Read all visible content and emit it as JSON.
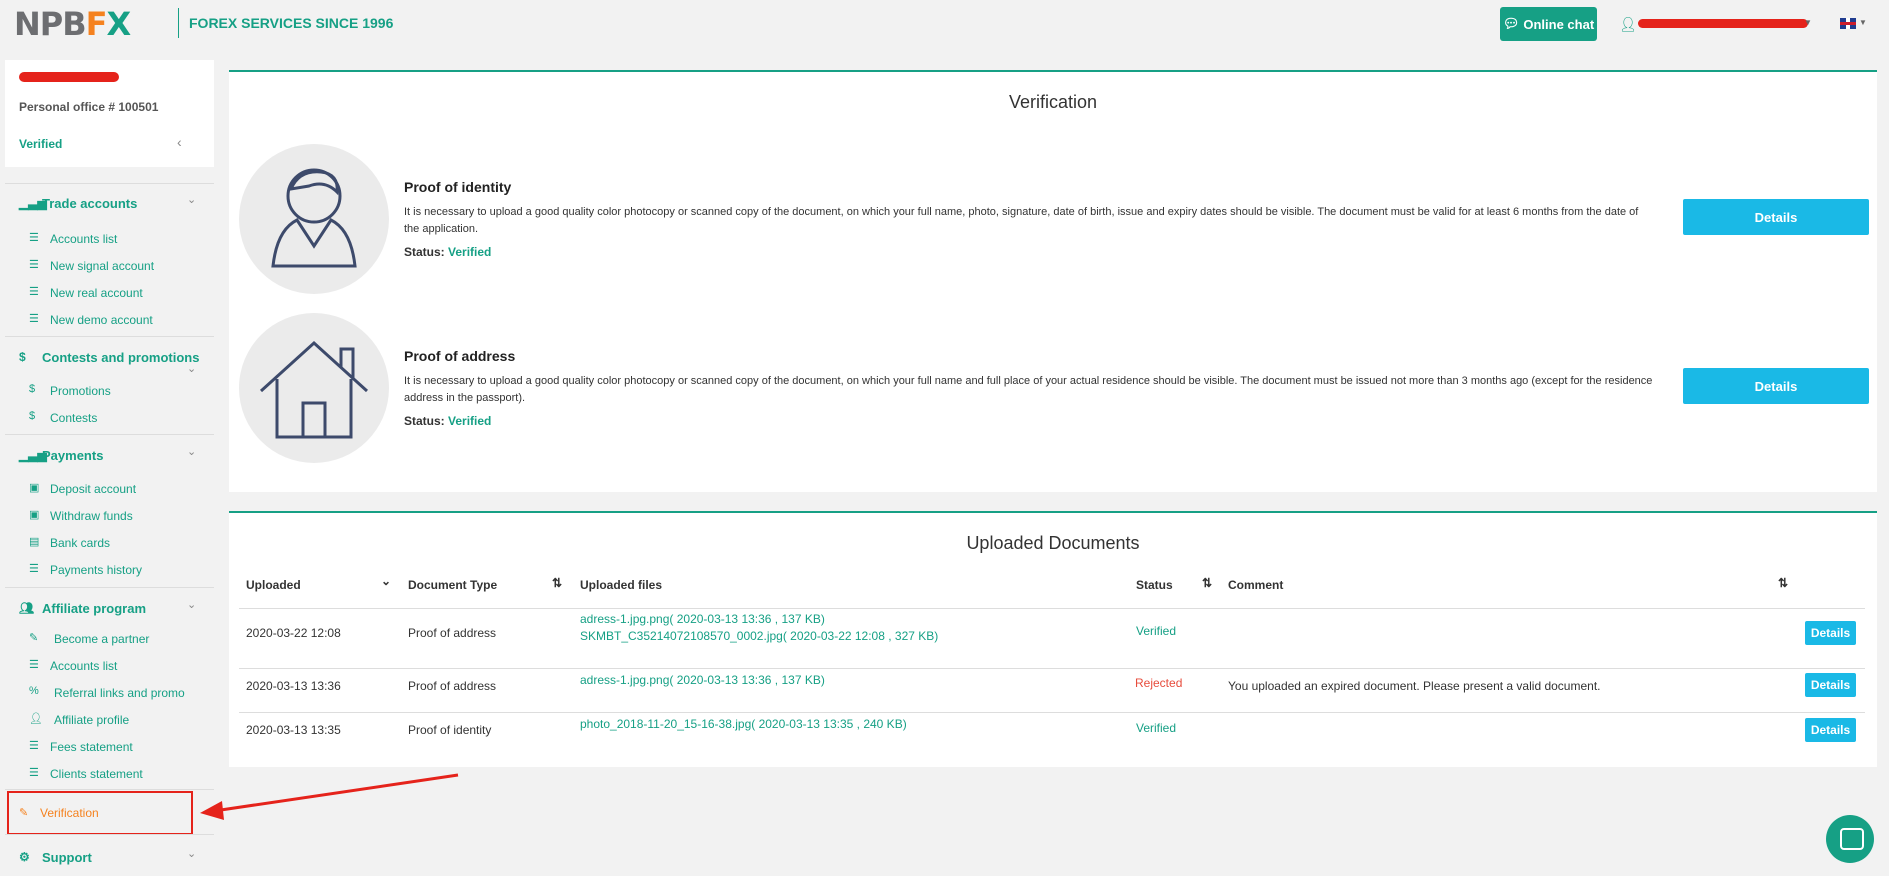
{
  "header": {
    "logo_npb": "NPB",
    "logo_f": "F",
    "logo_x": "X",
    "tagline": "FOREX SERVICES SINCE 1996",
    "online_chat_label": "Online chat"
  },
  "profile": {
    "office": "Personal office # 100501",
    "status": "Verified"
  },
  "sidebar": {
    "trade_accounts": {
      "label": "Trade accounts",
      "items": [
        "Accounts list",
        "New signal account",
        "New real account",
        "New demo account"
      ]
    },
    "contests": {
      "label": "Contests and promotions",
      "items": [
        "Promotions",
        "Contests"
      ]
    },
    "payments": {
      "label": "Payments",
      "items": [
        "Deposit account",
        "Withdraw funds",
        "Bank cards",
        "Payments history"
      ]
    },
    "affiliate": {
      "label": "Affiliate program",
      "items": [
        "Become a partner",
        "Accounts list",
        "Referral links and promo",
        "Affiliate profile",
        "Fees statement",
        "Clients statement"
      ]
    },
    "verification_label": "Verification",
    "support_label": "Support"
  },
  "verification": {
    "title": "Verification",
    "identity": {
      "title": "Proof of identity",
      "text": "It is necessary to upload a good quality color photocopy or scanned copy of the document, on which your full name, photo, signature, date of birth, issue and expiry dates should be visible. The document must be valid for at least 6 months from the date of the application.",
      "status_label": "Status:",
      "status_value": "Verified",
      "button": "Details"
    },
    "address": {
      "title": "Proof of address",
      "text": "It is necessary to upload a good quality color photocopy or scanned copy of the document, on which your full name and full place of your actual residence should be visible. The document must be issued not more than 3 months ago (except for the residence address in the passport).",
      "status_label": "Status:",
      "status_value": "Verified",
      "button": "Details"
    }
  },
  "uploads": {
    "title": "Uploaded Documents",
    "columns": [
      "Uploaded",
      "Document Type",
      "Uploaded files",
      "Status",
      "Comment"
    ],
    "rows": [
      {
        "uploaded": "2020-03-22 12:08",
        "type": "Proof of address",
        "files": [
          "adress-1.jpg.png( 2020-03-13 13:36 , 137 KB)",
          "SKMBT_C35214072108570_0002.jpg( 2020-03-22 12:08 , 327 KB)"
        ],
        "status": "Verified",
        "comment": "",
        "button": "Details"
      },
      {
        "uploaded": "2020-03-13 13:36",
        "type": "Proof of address",
        "files": [
          "adress-1.jpg.png( 2020-03-13 13:36 , 137 KB)"
        ],
        "status": "Rejected",
        "comment": "You uploaded an expired document. Please present a valid document.",
        "button": "Details"
      },
      {
        "uploaded": "2020-03-13 13:35",
        "type": "Proof of identity",
        "files": [
          "photo_2018-11-20_15-16-38.jpg( 2020-03-13 13:35 , 240 KB)"
        ],
        "status": "Verified",
        "comment": "",
        "button": "Details"
      }
    ]
  },
  "colors": {
    "brand_green": "#16a085",
    "accent_orange": "#f5821f",
    "button_blue": "#1ab9e6",
    "rejected_red": "#e74c3c",
    "annotation_red": "#e5231b"
  }
}
